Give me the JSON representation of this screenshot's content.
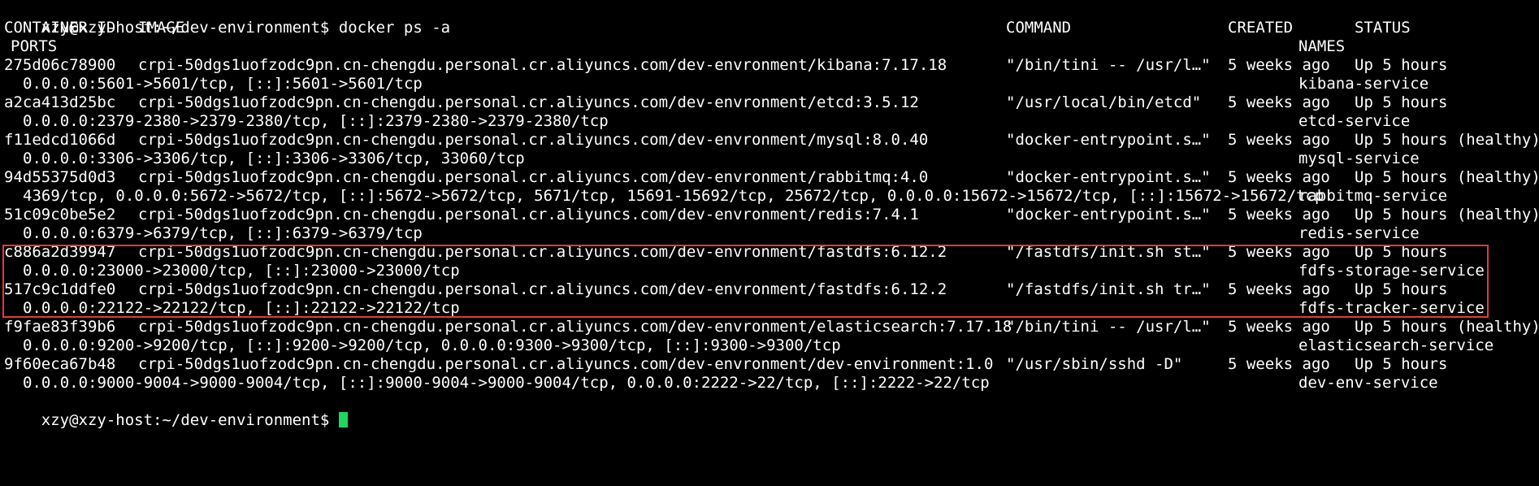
{
  "terminal": {
    "prompt": "xzy@xzy-host:~/dev-environment$ ",
    "command": "docker ps -a",
    "headers": {
      "container_id": "CONTAINER ID",
      "image": "IMAGE",
      "command": "COMMAND",
      "created": "CREATED",
      "status": "STATUS",
      "ports": "PORTS",
      "names": "NAMES"
    },
    "rows": [
      {
        "id": "275d06c78900",
        "image": "crpi-50dgs1uofzodc9pn.cn-chengdu.personal.cr.aliyuncs.com/dev-envronment/kibana:7.17.18",
        "command": "\"/bin/tini -- /usr/l…\"",
        "created": "5 weeks ago",
        "status": "Up 5 hours",
        "ports": "0.0.0.0:5601->5601/tcp, [::]:5601->5601/tcp",
        "name": "kibana-service"
      },
      {
        "id": "a2ca413d25bc",
        "image": "crpi-50dgs1uofzodc9pn.cn-chengdu.personal.cr.aliyuncs.com/dev-envronment/etcd:3.5.12",
        "command": "\"/usr/local/bin/etcd\"",
        "created": "5 weeks ago",
        "status": "Up 5 hours",
        "ports": "0.0.0.0:2379-2380->2379-2380/tcp, [::]:2379-2380->2379-2380/tcp",
        "name": "etcd-service"
      },
      {
        "id": "f11edcd1066d",
        "image": "crpi-50dgs1uofzodc9pn.cn-chengdu.personal.cr.aliyuncs.com/dev-envronment/mysql:8.0.40",
        "command": "\"docker-entrypoint.s…\"",
        "created": "5 weeks ago",
        "status": "Up 5 hours (healthy)",
        "ports": "0.0.0.0:3306->3306/tcp, [::]:3306->3306/tcp, 33060/tcp",
        "name": "mysql-service"
      },
      {
        "id": "94d55375d0d3",
        "image": "crpi-50dgs1uofzodc9pn.cn-chengdu.personal.cr.aliyuncs.com/dev-envronment/rabbitmq:4.0",
        "command": "\"docker-entrypoint.s…\"",
        "created": "5 weeks ago",
        "status": "Up 5 hours (healthy)",
        "ports": "4369/tcp, 0.0.0.0:5672->5672/tcp, [::]:5672->5672/tcp, 5671/tcp, 15691-15692/tcp, 25672/tcp, 0.0.0.0:15672->15672/tcp, [::]:15672->15672/tcp",
        "name": "rabbitmq-service"
      },
      {
        "id": "51c09c0be5e2",
        "image": "crpi-50dgs1uofzodc9pn.cn-chengdu.personal.cr.aliyuncs.com/dev-envronment/redis:7.4.1",
        "command": "\"docker-entrypoint.s…\"",
        "created": "5 weeks ago",
        "status": "Up 5 hours (healthy)",
        "ports": "0.0.0.0:6379->6379/tcp, [::]:6379->6379/tcp",
        "name": "redis-service"
      },
      {
        "id": "c886a2d39947",
        "image": "crpi-50dgs1uofzodc9pn.cn-chengdu.personal.cr.aliyuncs.com/dev-envronment/fastdfs:6.12.2",
        "command": "\"/fastdfs/init.sh st…\"",
        "created": "5 weeks ago",
        "status": "Up 5 hours",
        "ports": "0.0.0.0:23000->23000/tcp, [::]:23000->23000/tcp",
        "name": "fdfs-storage-service"
      },
      {
        "id": "517c9c1ddfe0",
        "image": "crpi-50dgs1uofzodc9pn.cn-chengdu.personal.cr.aliyuncs.com/dev-envronment/fastdfs:6.12.2",
        "command": "\"/fastdfs/init.sh tr…\"",
        "created": "5 weeks ago",
        "status": "Up 5 hours",
        "ports": "0.0.0.0:22122->22122/tcp, [::]:22122->22122/tcp",
        "name": "fdfs-tracker-service"
      },
      {
        "id": "f9fae83f39b6",
        "image": "crpi-50dgs1uofzodc9pn.cn-chengdu.personal.cr.aliyuncs.com/dev-envronment/elasticsearch:7.17.18",
        "command": "\"/bin/tini -- /usr/l…\"",
        "created": "5 weeks ago",
        "status": "Up 5 hours (healthy)",
        "ports": "0.0.0.0:9200->9200/tcp, [::]:9200->9200/tcp, 0.0.0.0:9300->9300/tcp, [::]:9300->9300/tcp",
        "name": "elasticsearch-service"
      },
      {
        "id": "9f60eca67b48",
        "image": "crpi-50dgs1uofzodc9pn.cn-chengdu.personal.cr.aliyuncs.com/dev-envronment/dev-environment:1.0",
        "command": "\"/usr/sbin/sshd -D\"",
        "created": "5 weeks ago",
        "status": "Up 5 hours",
        "ports": "0.0.0.0:9000-9004->9000-9004/tcp, [::]:9000-9004->9000-9004/tcp, 0.0.0.0:2222->22/tcp, [::]:2222->22/tcp",
        "name": "dev-env-service"
      }
    ],
    "colors": {
      "background": "#000000",
      "text": "#ffffff",
      "highlight": "#e53935",
      "cursor": "#1ed760"
    }
  }
}
